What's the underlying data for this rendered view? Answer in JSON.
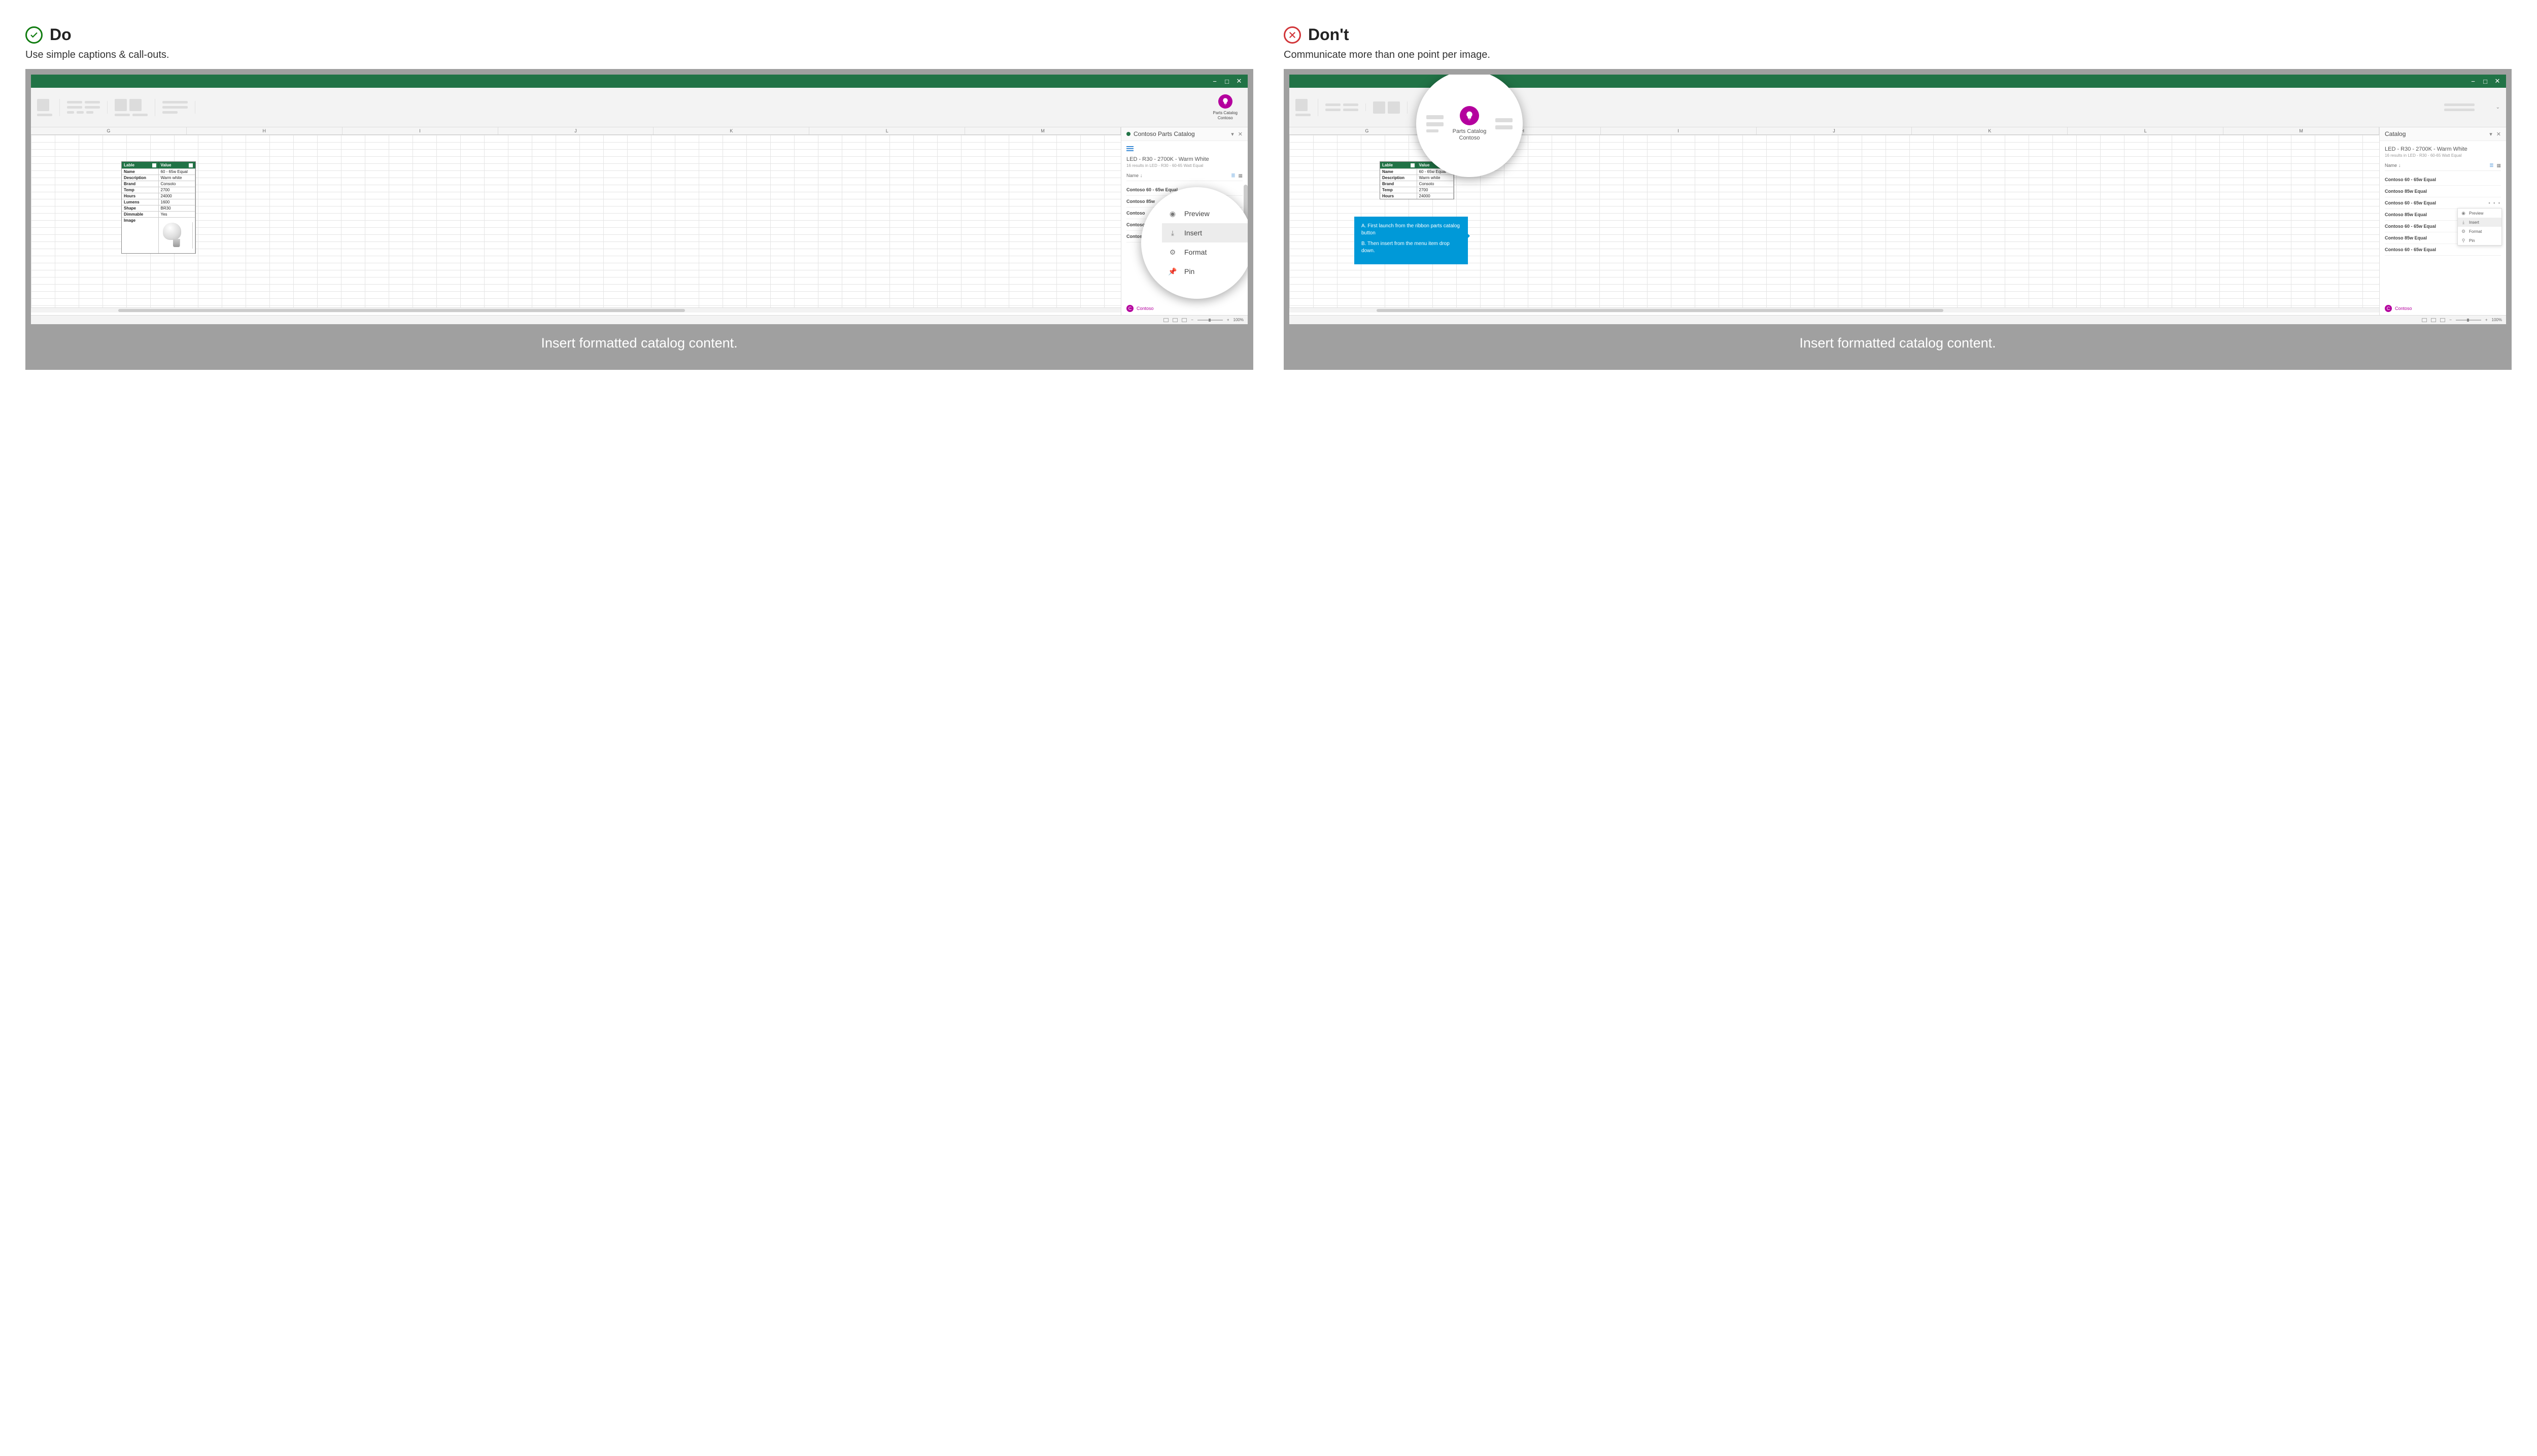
{
  "do": {
    "title": "Do",
    "subtitle": "Use simple captions & call-outs.",
    "caption": "Insert formatted catalog content."
  },
  "dont": {
    "title": "Don't",
    "subtitle": "Communicate more than one point per image.",
    "caption": "Insert formatted catalog content."
  },
  "ribbon_button": {
    "line1": "Parts Catalog",
    "line2": "Contoso"
  },
  "columns": [
    "G",
    "H",
    "I",
    "J",
    "K",
    "L",
    "M"
  ],
  "table": {
    "head": {
      "c1": "Lable",
      "c2": "Value"
    },
    "rows": [
      {
        "k": "Name",
        "v": "60 - 65w Equal"
      },
      {
        "k": "Description",
        "v": "Warm white"
      },
      {
        "k": "Brand",
        "v": "Consoto"
      },
      {
        "k": "Temp",
        "v": "2700"
      },
      {
        "k": "Hours",
        "v": "24000"
      },
      {
        "k": "Lumens",
        "v": "1600"
      },
      {
        "k": "Shape",
        "v": "BR30"
      },
      {
        "k": "Dimmable",
        "v": "Yes"
      },
      {
        "k": "Image",
        "v": ""
      }
    ]
  },
  "pane": {
    "title": "Contoso Parts Catalog",
    "search_title": "LED - R30 - 2700K - Warm White",
    "search_sub": "16 results in LED - R30 - 60-65 Watt Equal",
    "sort_label": "Name",
    "signed_user": "Contoso",
    "signed_badge": "C"
  },
  "items_do": [
    "Contoso 60 - 65w Equal",
    "Contoso 85w",
    "Contoso",
    "Contoso",
    "Contoso"
  ],
  "items_dont": [
    "Contoso 60 - 65w Equal",
    "Contoso 85w Equal",
    "Contoso 60 - 65w Equal",
    "Contoso 85w Equal",
    "Contoso 60 - 65w Equal",
    "Contoso 85w Equal",
    "Contoso 60 - 65w Equal"
  ],
  "zoom_menu": {
    "preview": "Preview",
    "insert": "Insert",
    "format": "Format",
    "pin": "Pin"
  },
  "dd_menu": {
    "preview": "Preview",
    "insert": "Insert",
    "format": "Format",
    "pin": "Pin"
  },
  "callout": {
    "a": "A.  First launch from the ribbon parts catalog button",
    "b": "B.  Then insert from the menu item drop down."
  },
  "status": {
    "zoom": "100%",
    "minus": "−",
    "plus": "+"
  }
}
